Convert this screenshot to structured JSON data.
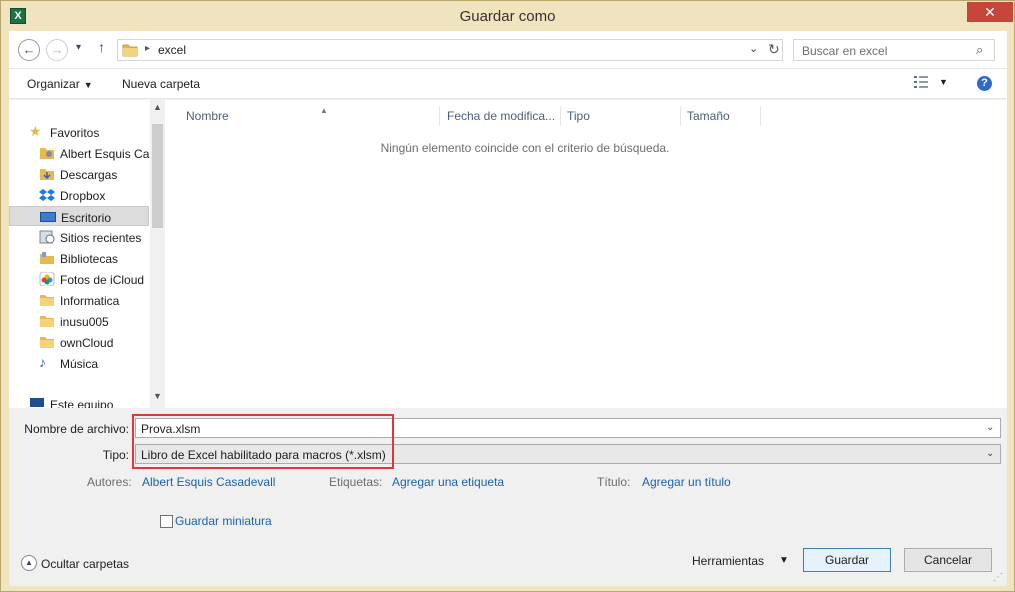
{
  "window": {
    "title": "Guardar como",
    "app_icon": "excel-icon",
    "close_glyph": "✕"
  },
  "navbar": {
    "back_glyph": "←",
    "forward_glyph": "→",
    "recent_glyph": "▾",
    "up_glyph": "↑",
    "path_separator": "▸",
    "current_folder": "excel",
    "dropdown_glyph": "⌄",
    "refresh_glyph": "↻",
    "search_placeholder": "Buscar en excel",
    "search_glyph": "⌕"
  },
  "toolbar": {
    "organize_label": "Organizar",
    "organize_caret": "▼",
    "new_folder_label": "Nueva carpeta",
    "view_caret": "▼",
    "help_glyph": "?"
  },
  "sidebar": {
    "items": [
      {
        "label": "Favoritos",
        "icon": "star-icon"
      },
      {
        "label": "Albert Esquis Casadevall",
        "icon": "user-folder-icon"
      },
      {
        "label": "Descargas",
        "icon": "downloads-icon"
      },
      {
        "label": "Dropbox",
        "icon": "dropbox-icon"
      },
      {
        "label": "Escritorio",
        "icon": "desktop-icon",
        "selected": true
      },
      {
        "label": "Sitios recientes",
        "icon": "recent-places-icon"
      },
      {
        "label": "Bibliotecas",
        "icon": "libraries-icon"
      },
      {
        "label": "Fotos de iCloud",
        "icon": "icloud-photos-icon"
      },
      {
        "label": "Informatica",
        "icon": "folder-icon"
      },
      {
        "label": "inusu005",
        "icon": "folder-icon"
      },
      {
        "label": "ownCloud",
        "icon": "folder-icon"
      },
      {
        "label": "Música",
        "icon": "music-icon"
      },
      {
        "label": "Este equipo",
        "icon": "computer-icon"
      }
    ],
    "scroll_up_glyph": "▲",
    "scroll_down_glyph": "▼"
  },
  "file_list": {
    "columns": [
      "Nombre",
      "Fecha de modifica...",
      "Tipo",
      "Tamaño"
    ],
    "sort_glyph": "▲",
    "empty_message": "Ningún elemento coincide con el criterio de búsqueda."
  },
  "form": {
    "filename_label": "Nombre de archivo:",
    "filename_value": "Prova.xlsm",
    "type_label": "Tipo:",
    "type_value": "Libro de Excel habilitado para macros (*.xlsm)",
    "caret_glyph": "⌄",
    "authors_label": "Autores:",
    "authors_value": "Albert Esquis Casadevall",
    "tags_label": "Etiquetas:",
    "tags_value": "Agregar una etiqueta",
    "title_label": "Título:",
    "title_value": "Agregar un título",
    "thumbnail_label": "Guardar miniatura",
    "thumbnail_checked": false
  },
  "footer": {
    "hide_folders_glyph": "▲",
    "hide_folders_label": "Ocultar carpetas",
    "tools_label": "Herramientas",
    "tools_caret": "▼",
    "save_label": "Guardar",
    "cancel_label": "Cancelar",
    "grip_glyph": "⋰"
  },
  "colors": {
    "frame": "#f0e4be",
    "close": "#c7463b",
    "link": "#1a62b5",
    "highlight": "#d8393a",
    "folder": "#e8b94a"
  }
}
